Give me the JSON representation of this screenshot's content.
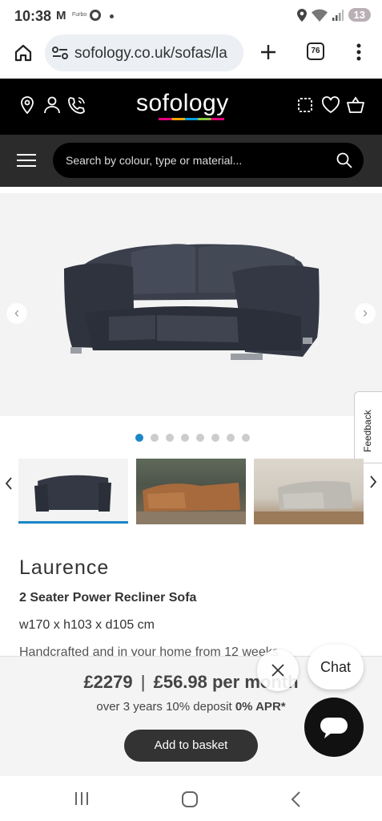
{
  "status_bar": {
    "time": "10:38",
    "app_badge": "Furbo",
    "battery": "13"
  },
  "browser": {
    "url": "sofology.co.uk/sofas/la",
    "tab_count": "76"
  },
  "site": {
    "logo": "sofology",
    "search_placeholder": "Search by colour, type or material..."
  },
  "gallery": {
    "dot_count": 8,
    "active_dot": 0,
    "feedback_label": "Feedback"
  },
  "product": {
    "name": "Laurence",
    "type": "2 Seater Power Recliner Sofa",
    "dimensions": "w170 x h103 x d105 cm",
    "delivery": "Handcrafted and in your home from 12 weeks"
  },
  "purchase": {
    "price": "£2279",
    "separator": "|",
    "monthly": "£56.98 per month",
    "finance_prefix": "over 3 years 10% deposit",
    "finance_apr": "0% APR*",
    "add_button": "Add to basket"
  },
  "chat": {
    "label": "Chat"
  },
  "colors": {
    "brand_black": "#000000",
    "dot_active": "#1b87c7",
    "button_dark": "#333333"
  }
}
